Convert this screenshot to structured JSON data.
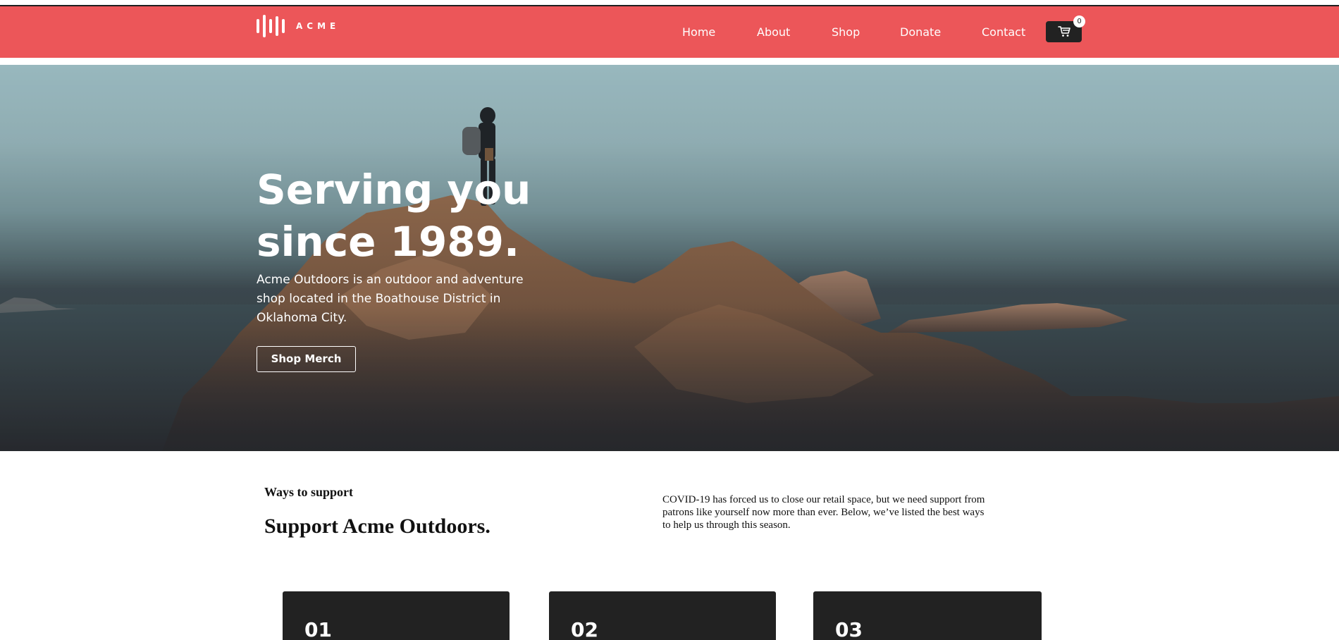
{
  "header": {
    "brand": "ACME",
    "nav": [
      {
        "label": "Home"
      },
      {
        "label": "About"
      },
      {
        "label": "Shop"
      },
      {
        "label": "Donate"
      },
      {
        "label": "Contact"
      }
    ],
    "cart_count": "0",
    "accent_color": "#ec5659"
  },
  "hero": {
    "title": "Serving you since 1989.",
    "description": "Acme Outdoors is an outdoor and adventure shop located in the Boathouse District in Oklahoma City.",
    "button_label": "Shop Merch"
  },
  "support": {
    "eyebrow": "Ways to support",
    "title": "Support Acme Outdoors.",
    "description": "COVID-19 has forced us to close our retail space, but we need support from patrons like yourself now more than ever. Below, we’ve listed the best ways to help us through this season.",
    "cards": [
      {
        "number": "01"
      },
      {
        "number": "02"
      },
      {
        "number": "03"
      }
    ]
  }
}
